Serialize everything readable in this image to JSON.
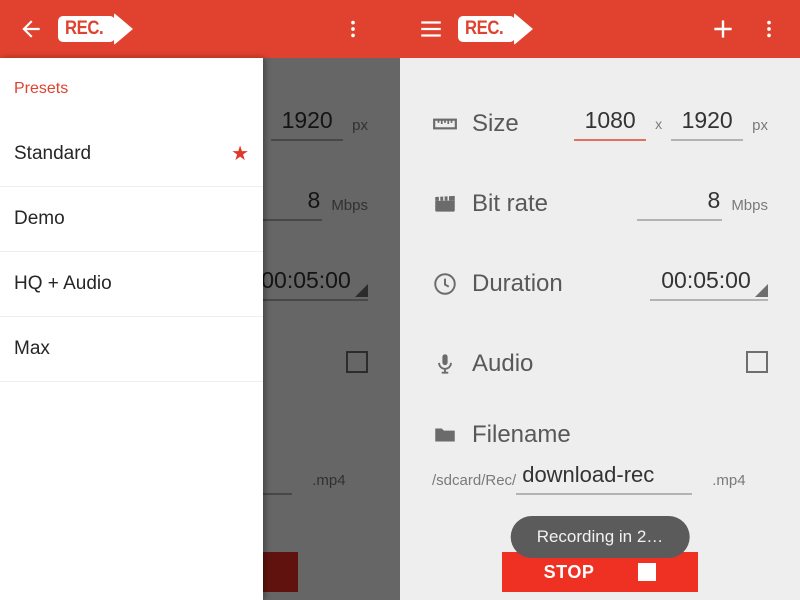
{
  "left": {
    "appbar": {
      "back_icon": "arrow-back-icon",
      "logo_text": "REC.",
      "overflow_icon": "overflow-menu-icon"
    },
    "drawer": {
      "title": "Presets",
      "items": [
        {
          "label": "Standard",
          "starred": true,
          "star": "★"
        },
        {
          "label": "Demo",
          "starred": false,
          "star": ""
        },
        {
          "label": "HQ + Audio",
          "starred": false,
          "star": ""
        },
        {
          "label": "Max",
          "starred": false,
          "star": ""
        }
      ]
    }
  },
  "right": {
    "appbar": {
      "menu_icon": "hamburger-menu-icon",
      "logo_text": "REC.",
      "add_icon": "plus-icon",
      "overflow_icon": "overflow-menu-icon"
    },
    "form": {
      "size": {
        "label": "Size",
        "icon": "ruler-icon",
        "width": "1080",
        "separator": "x",
        "height": "1920",
        "unit": "px"
      },
      "bitrate": {
        "label": "Bit rate",
        "icon": "clapperboard-icon",
        "value": "8",
        "unit": "Mbps"
      },
      "duration": {
        "label": "Duration",
        "icon": "clock-icon",
        "value": "00:05:00"
      },
      "audio": {
        "label": "Audio",
        "icon": "microphone-icon",
        "checked": false
      },
      "filename": {
        "label": "Filename",
        "icon": "folder-icon",
        "prefix": "/sdcard/Rec/",
        "value": "download-rec",
        "suffix": ".mp4"
      }
    },
    "toast": "Recording in 2…",
    "stop_button": {
      "label": "STOP",
      "icon": "stop-square-icon"
    }
  },
  "colors": {
    "accent_red": "#e0422f",
    "stop_red": "#ef3124",
    "panel_bg": "#eeeeee",
    "scrim": "rgba(0,0,0,0.60)",
    "toast_bg": "#5b5b5b",
    "star_red": "#e0372b"
  }
}
